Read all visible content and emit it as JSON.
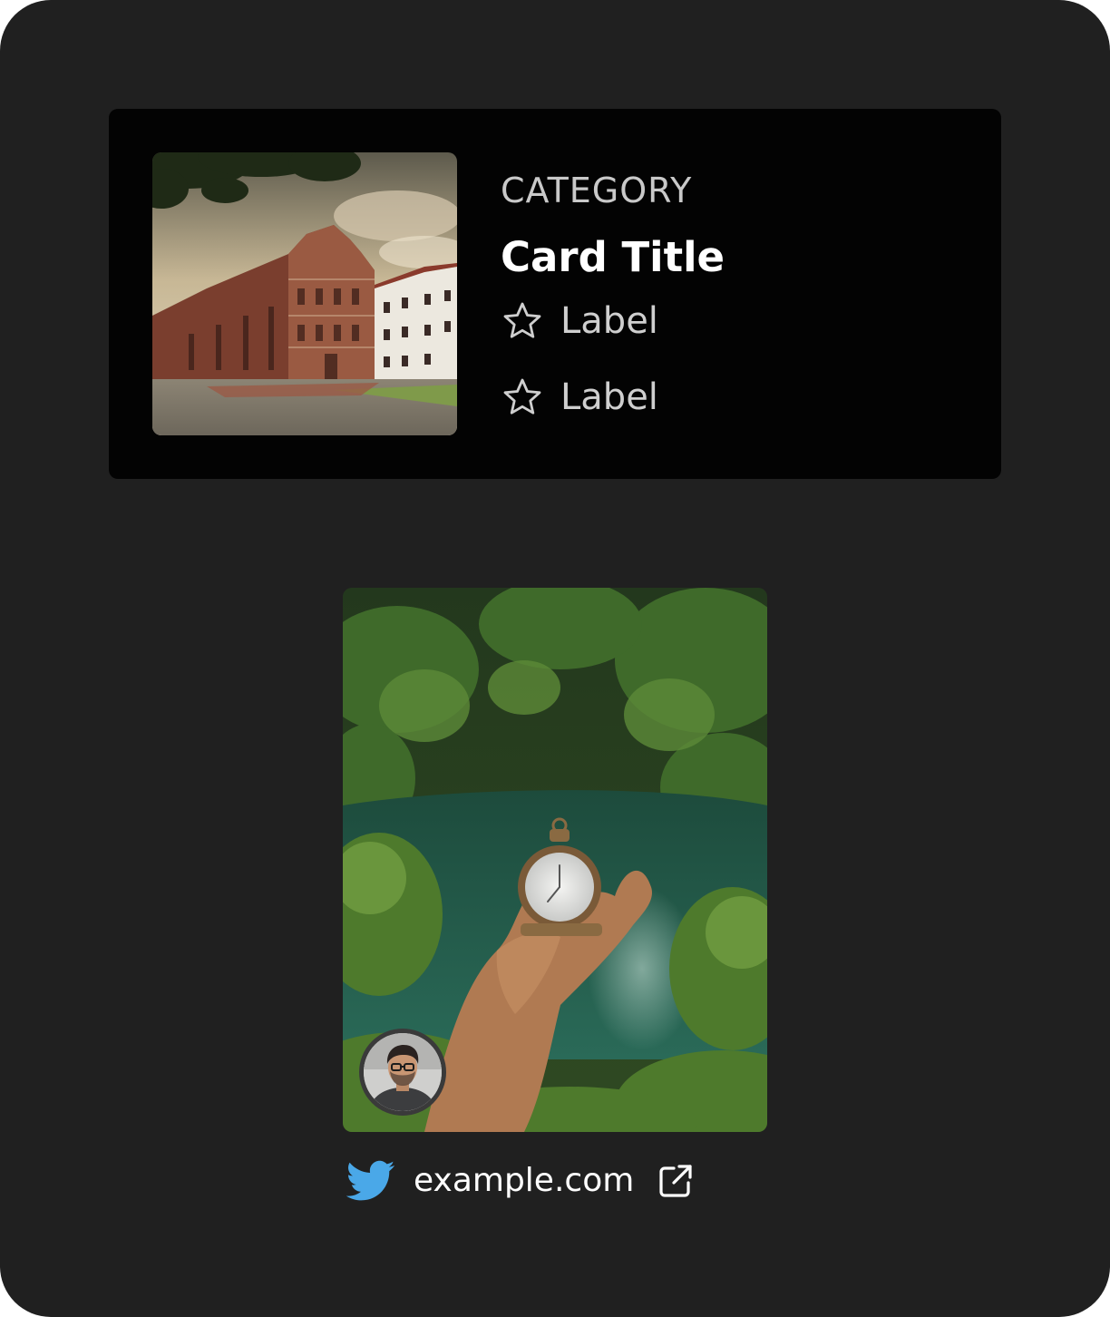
{
  "horizontal_card": {
    "category": "CATEGORY",
    "title": "Card Title",
    "labels": [
      {
        "icon": "star-outline-icon",
        "text": "Label"
      },
      {
        "icon": "star-outline-icon",
        "text": "Label"
      }
    ],
    "image": "church-photo"
  },
  "media_card": {
    "image": "pocket-watch-forest-photo",
    "avatar": "user-avatar",
    "social_icon": "twitter-icon",
    "link_text": "example.com",
    "link_icon": "external-link-icon"
  },
  "colors": {
    "page_background": "#202020",
    "card_background": "#030303",
    "twitter_blue": "#4aa8e8",
    "label_text": "#cfcfcf"
  }
}
